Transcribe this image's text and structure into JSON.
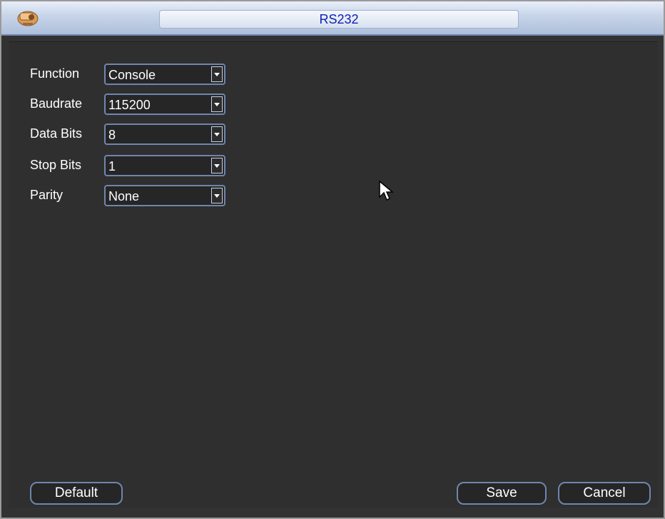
{
  "window": {
    "title": "RS232",
    "icon": "camera-icon"
  },
  "form": {
    "fields": [
      {
        "label": "Function",
        "value": "Console"
      },
      {
        "label": "Baudrate",
        "value": "115200"
      },
      {
        "label": "Data Bits",
        "value": "8"
      },
      {
        "label": "Stop Bits",
        "value": "1"
      },
      {
        "label": "Parity",
        "value": "None"
      }
    ]
  },
  "buttons": {
    "default_label": "Default",
    "save_label": "Save",
    "cancel_label": "Cancel"
  },
  "colors": {
    "title_text": "#1020b8",
    "accent_border": "#6f86ad",
    "background": "#2f2f2f"
  }
}
